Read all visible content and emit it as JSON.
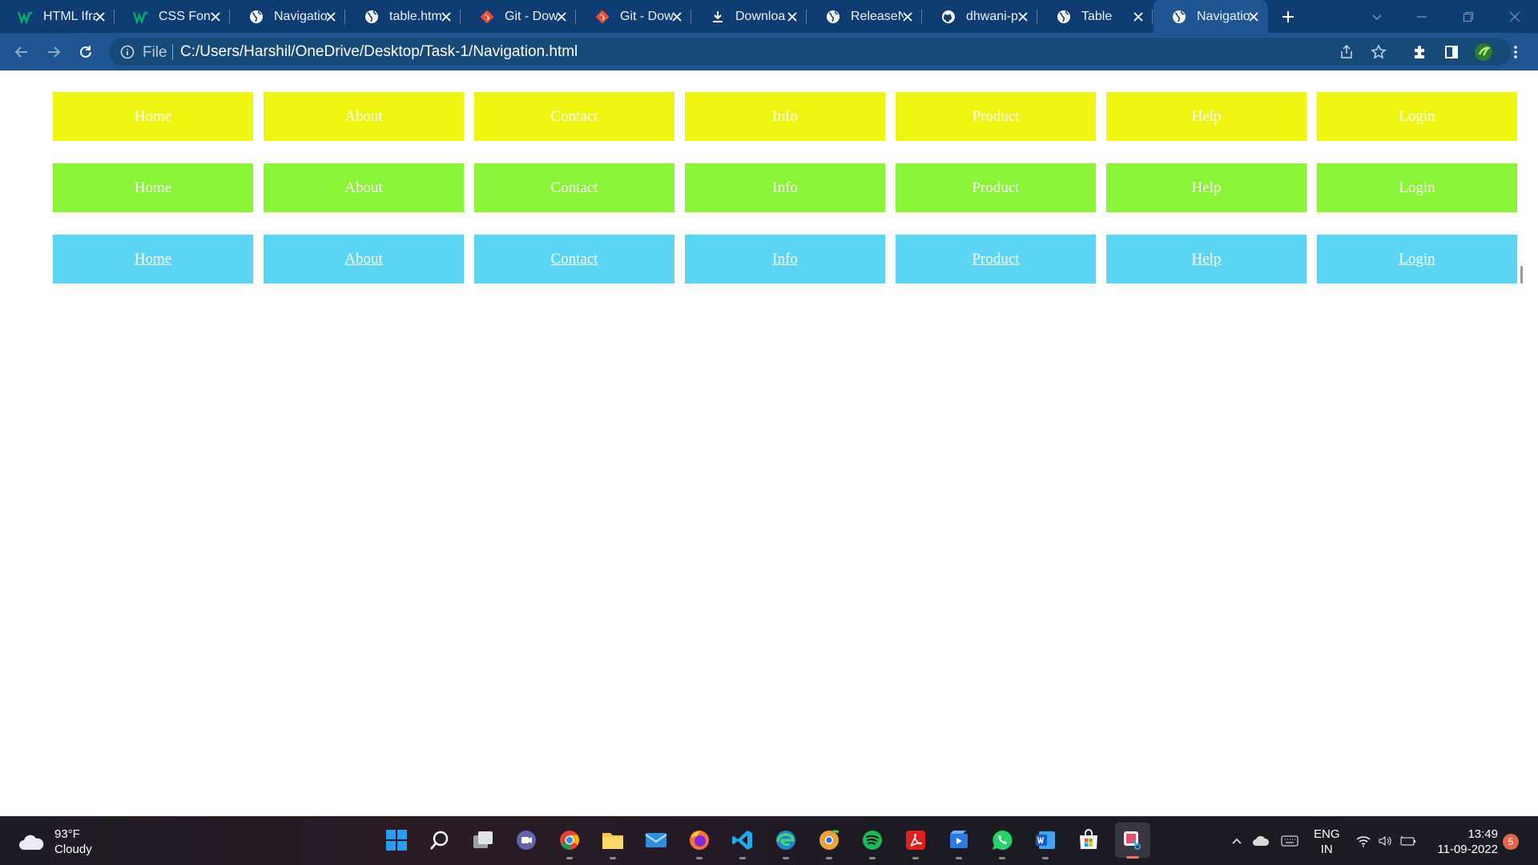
{
  "browser": {
    "tabs": [
      {
        "title": "HTML Ifra",
        "icon": "w3schools-icon",
        "active": false
      },
      {
        "title": "CSS Fonts",
        "icon": "w3schools-icon",
        "active": false
      },
      {
        "title": "Navigatio",
        "icon": "globe-icon",
        "active": false
      },
      {
        "title": "table.htm",
        "icon": "globe-icon",
        "active": false
      },
      {
        "title": "Git - Dow",
        "icon": "git-icon",
        "active": false
      },
      {
        "title": "Git - Dow",
        "icon": "git-icon",
        "active": false
      },
      {
        "title": "Downloa",
        "icon": "download-icon",
        "active": false
      },
      {
        "title": "ReleaseN",
        "icon": "globe-icon",
        "active": false
      },
      {
        "title": "dhwani-p",
        "icon": "github-icon",
        "active": false
      },
      {
        "title": "Table",
        "icon": "globe-icon",
        "active": false
      },
      {
        "title": "Navigatio",
        "icon": "globe-icon",
        "active": true
      }
    ],
    "address": {
      "scheme_label": "File",
      "url": "C:/Users/Harshil/OneDrive/Desktop/Task-1/Navigation.html"
    }
  },
  "page": {
    "nav_rows": [
      {
        "style": "yellow",
        "items": [
          "Home",
          "About",
          "Contact",
          "Info",
          "Product",
          "Help",
          "Login"
        ]
      },
      {
        "style": "green",
        "items": [
          "Home",
          "About",
          "Contact",
          "Info",
          "Product",
          "Help",
          "Login"
        ]
      },
      {
        "style": "blue-link",
        "items": [
          "Home",
          "About",
          "Contact",
          "Info",
          "Product",
          "Help",
          "Login"
        ]
      }
    ]
  },
  "taskbar": {
    "weather": {
      "temp": "93°F",
      "condition": "Cloudy"
    },
    "apps": [
      "start-icon",
      "search-icon",
      "task-view-icon",
      "teams-chat-icon",
      "chrome-icon",
      "file-explorer-icon",
      "mail-icon",
      "firefox-icon",
      "vscode-icon",
      "edge-icon",
      "chrome-canary-icon",
      "spotify-icon",
      "acrobat-icon",
      "video-editor-icon",
      "whatsapp-icon",
      "word-icon",
      "microsoft-store-icon",
      "snipping-tool-icon"
    ],
    "language": {
      "line1": "ENG",
      "line2": "IN"
    },
    "clock": {
      "time": "13:49",
      "date": "11-09-2022"
    },
    "notifications": "5"
  },
  "colors": {
    "tabstrip": "#0f3d73",
    "toolbar": "#1f5592",
    "row_yellow": "#eef510",
    "row_green": "#8af537",
    "row_blue": "#5bd5f3"
  }
}
